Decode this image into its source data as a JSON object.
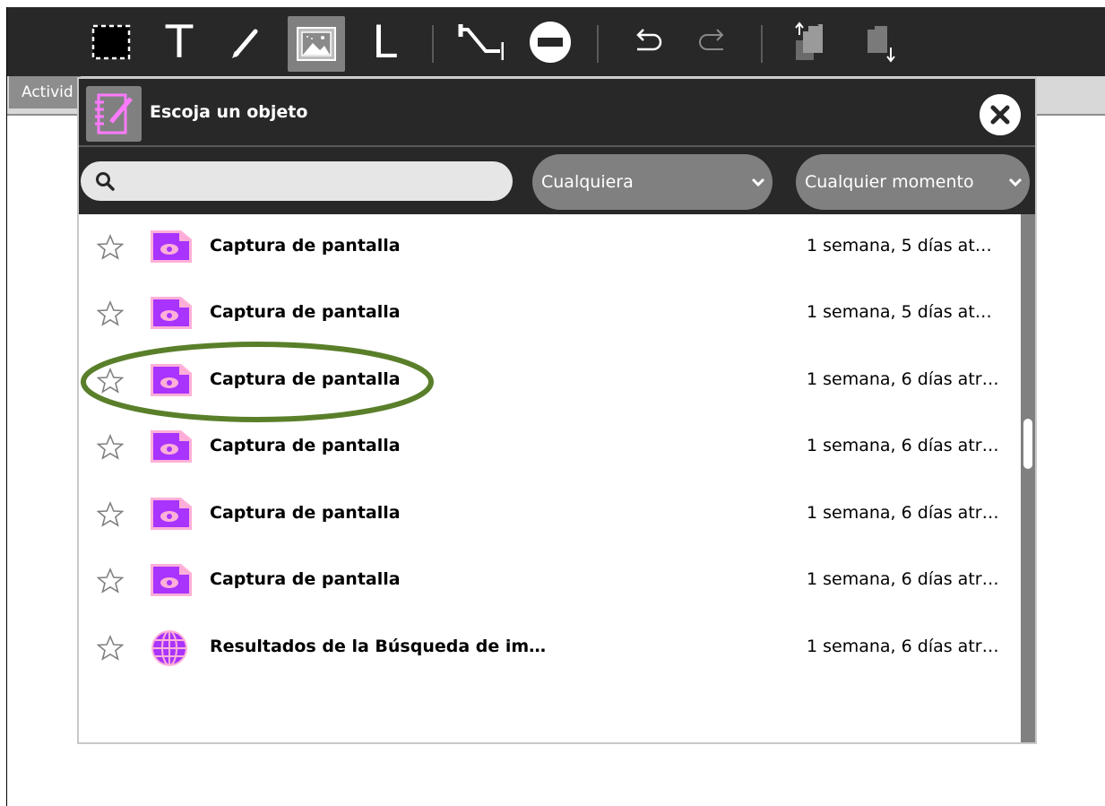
{
  "toolbar": {
    "items": [
      {
        "icon": "select-rectangle-icon"
      },
      {
        "icon": "text-tool-icon"
      },
      {
        "icon": "pencil-icon"
      },
      {
        "icon": "insert-image-icon",
        "active": true
      },
      {
        "icon": "letter-l-icon"
      },
      {
        "icon": "connector-icon"
      },
      {
        "icon": "remove-icon"
      },
      {
        "icon": "undo-icon"
      },
      {
        "icon": "redo-icon"
      },
      {
        "icon": "bring-to-front-icon"
      },
      {
        "icon": "send-to-back-icon"
      }
    ],
    "text_glyph": "T",
    "l_glyph": "L"
  },
  "activity": {
    "tab_label": "Activid"
  },
  "dialog": {
    "title": "Escoja un objeto",
    "search": {
      "value": "",
      "placeholder": ""
    },
    "filter_type": "Cualquiera",
    "filter_time": "Cualquier momento",
    "accent": "#a933ff",
    "items": [
      {
        "title": "Captura de pantalla",
        "date": "1 semana, 5 días at…",
        "icon": "image-file-icon"
      },
      {
        "title": "Captura de pantalla",
        "date": "1 semana, 5 días at…",
        "icon": "image-file-icon"
      },
      {
        "title": "Captura de pantalla",
        "date": "1 semana, 6 días atr…",
        "icon": "image-file-icon"
      },
      {
        "title": "Captura de pantalla",
        "date": "1 semana, 6 días atr…",
        "icon": "image-file-icon"
      },
      {
        "title": "Captura de pantalla",
        "date": "1 semana, 6 días atr…",
        "icon": "image-file-icon"
      },
      {
        "title": "Captura de pantalla",
        "date": "1 semana, 6 días atr…",
        "icon": "image-file-icon"
      },
      {
        "title": "Resultados de la Búsqueda de im…",
        "date": "1 semana, 6 días atr…",
        "icon": "web-globe-icon"
      }
    ]
  },
  "annotation": {
    "color": "#5a7f2a"
  }
}
